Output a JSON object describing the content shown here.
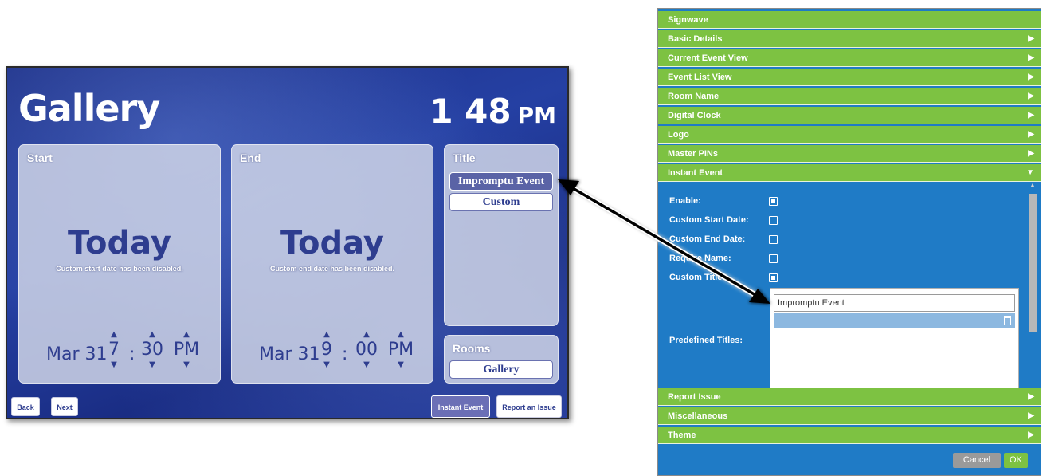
{
  "device": {
    "room_title": "Gallery",
    "clock_time": "1 48",
    "clock_ampm": "PM",
    "start": {
      "label": "Start",
      "big_text": "Today",
      "message": "Custom start date has been disabled.",
      "date": "Mar 31",
      "hour": "7",
      "minute": "30",
      "ampm": "PM"
    },
    "end": {
      "label": "End",
      "big_text": "Today",
      "message": "Custom end date has been disabled.",
      "date": "Mar 31",
      "hour": "9",
      "minute": "00",
      "ampm": "PM"
    },
    "title_panel": {
      "label": "Title",
      "options": [
        "Impromptu Event",
        "Custom"
      ]
    },
    "rooms_panel": {
      "label": "Rooms",
      "value": "Gallery"
    },
    "buttons": {
      "back": "Back",
      "next": "Next",
      "instant_event": "Instant Event",
      "report_issue": "Report an Issue"
    }
  },
  "settings": {
    "header": "Signwave",
    "sections": [
      "Basic Details",
      "Current Event View",
      "Event List View",
      "Room Name",
      "Digital Clock",
      "Logo",
      "Master PINs",
      "Instant Event"
    ],
    "instant_event": {
      "enable_label": "Enable:",
      "custom_start_label": "Custom Start Date:",
      "custom_end_label": "Custom End Date:",
      "require_name_label": "Require Name:",
      "custom_title_label": "Custom Title:",
      "predefined_label": "Predefined Titles:",
      "predefined_titles": [
        "Impromptu Event"
      ],
      "enable": true,
      "custom_start": false,
      "custom_end": false,
      "require_name": false,
      "custom_title": true
    },
    "bottom_sections": [
      "Report Issue",
      "Miscellaneous",
      "Theme"
    ],
    "cancel": "Cancel",
    "ok": "OK"
  },
  "icons": {
    "expand_arrow": "▶",
    "collapse_arrow": "▼",
    "spin_up": "▲",
    "spin_down": "▼"
  },
  "colors": {
    "device_blue": "#2540a3",
    "accent_purple": "#5a63a6",
    "settings_green": "#7dc242",
    "settings_blue": "#1f7bc6"
  }
}
